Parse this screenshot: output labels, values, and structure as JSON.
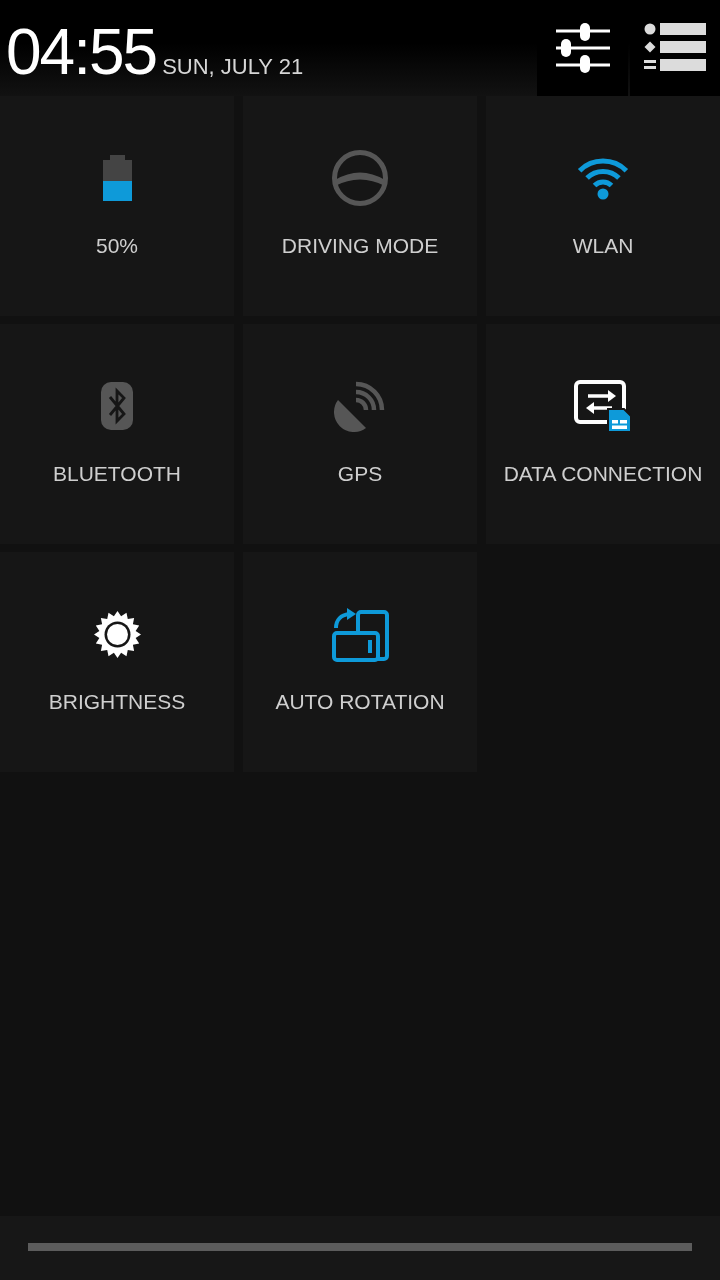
{
  "header": {
    "time": "04:55",
    "date": "SUN, JULY 21"
  },
  "tiles": [
    {
      "label": "50%",
      "kind": "battery"
    },
    {
      "label": "DRIVING MODE",
      "kind": "driving",
      "on": false
    },
    {
      "label": "WLAN",
      "kind": "wifi",
      "on": true
    },
    {
      "label": "BLUETOOTH",
      "kind": "bluetooth",
      "on": false
    },
    {
      "label": "GPS",
      "kind": "gps",
      "on": false
    },
    {
      "label": "DATA CONNECTION",
      "kind": "data",
      "on": true
    },
    {
      "label": "BRIGHTNESS",
      "kind": "brightness"
    },
    {
      "label": "AUTO ROTATION",
      "kind": "rotation",
      "on": true
    }
  ]
}
